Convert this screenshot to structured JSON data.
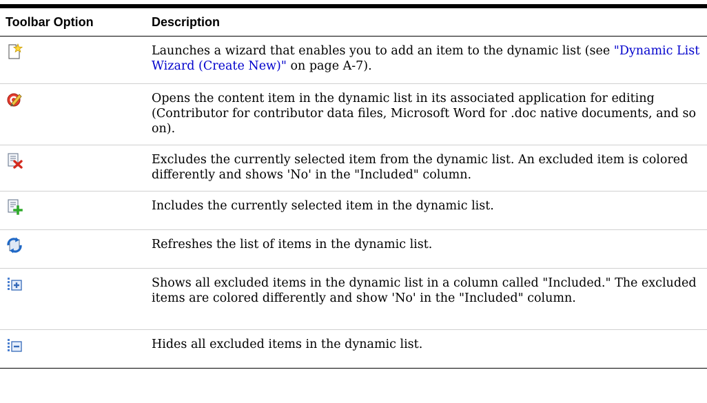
{
  "table": {
    "headers": {
      "option": "Toolbar Option",
      "description": "Description"
    },
    "rows": [
      {
        "icon": "new-document-star-icon",
        "desc_before": "Launches a wizard that enables you to add an item to the dynamic list (see ",
        "link_text": "\"Dynamic List Wizard (Create New)\"",
        "desc_after": " on page A-7)."
      },
      {
        "icon": "edit-pencil-icon",
        "description": "Opens the content item in the dynamic list in its associated application for editing (Contributor for contributor data files, Microsoft Word for .doc native documents, and so on)."
      },
      {
        "icon": "exclude-item-icon",
        "description": "Excludes the currently selected item from the dynamic list. An excluded item is colored differently and shows 'No' in the \"Included\" column."
      },
      {
        "icon": "include-item-icon",
        "description": "Includes the currently selected item in the dynamic list."
      },
      {
        "icon": "refresh-icon",
        "description": "Refreshes the list of items in the dynamic list."
      },
      {
        "icon": "show-excluded-icon",
        "description": "Shows all excluded items in the dynamic list in a column called \"Included.\" The excluded items are colored differently and show 'No' in the \"Included\" column."
      },
      {
        "icon": "hide-excluded-icon",
        "description": "Hides all excluded items in the dynamic list."
      }
    ]
  },
  "colors": {
    "link": "#0000cc",
    "rule": "#000000",
    "divider": "#d0d0d0"
  }
}
